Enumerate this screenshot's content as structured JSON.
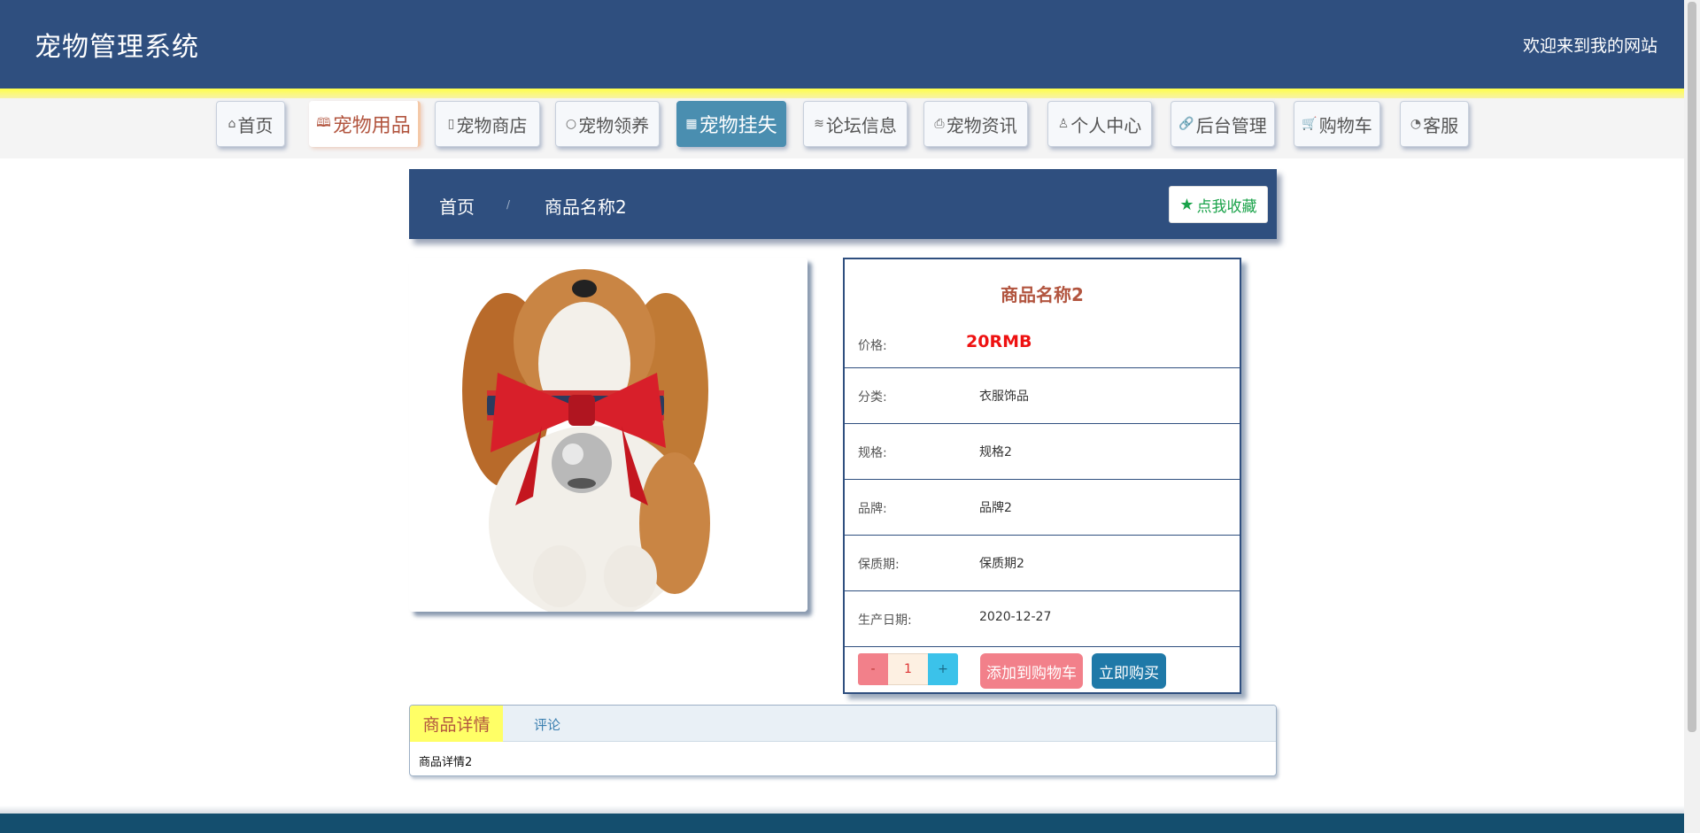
{
  "header": {
    "title": "宠物管理系统",
    "welcome": "欢迎来到我的网站"
  },
  "nav": {
    "items": [
      {
        "label": "首页",
        "icon": "home-icon",
        "glyph": "⌂"
      },
      {
        "label": "宠物用品",
        "icon": "book-icon",
        "glyph": "🕮"
      },
      {
        "label": "宠物商店",
        "icon": "document-icon",
        "glyph": "▯"
      },
      {
        "label": "宠物领养",
        "icon": "circle-icon",
        "glyph": "○"
      },
      {
        "label": "宠物挂失",
        "icon": "grid-icon",
        "glyph": "▦"
      },
      {
        "label": "论坛信息",
        "icon": "layers-icon",
        "glyph": "≋"
      },
      {
        "label": "宠物资讯",
        "icon": "print-icon",
        "glyph": "⎙"
      },
      {
        "label": "个人中心",
        "icon": "user-icon",
        "glyph": "♙"
      },
      {
        "label": "后台管理",
        "icon": "link-icon",
        "glyph": "🔗"
      },
      {
        "label": "购物车",
        "icon": "cart-icon",
        "glyph": "🛒"
      },
      {
        "label": "客服",
        "icon": "support-icon",
        "glyph": "◔"
      }
    ],
    "active_index": 4,
    "accent_index": 1
  },
  "breadcrumb": {
    "home": "首页",
    "separator": "/",
    "current": "商品名称2",
    "favorite_label": "点我收藏",
    "favorite_icon": "star-icon"
  },
  "product": {
    "image_alt": "dog-with-bell-collar",
    "name": "商品名称2",
    "price_label": "价格:",
    "price": "20RMB",
    "fields": [
      {
        "label": "分类:",
        "value": "衣服饰品"
      },
      {
        "label": "规格:",
        "value": "规格2"
      },
      {
        "label": "品牌:",
        "value": "品牌2"
      },
      {
        "label": "保质期:",
        "value": "保质期2"
      },
      {
        "label": "生产日期:",
        "value": "2020-12-27"
      }
    ],
    "quantity": {
      "minus": "-",
      "value": "1",
      "plus": "+"
    },
    "add_to_cart": "添加到购物车",
    "buy_now": "立即购买"
  },
  "tabs": {
    "detail_tab": "商品详情",
    "comment_tab": "评论",
    "detail_text": "商品详情2"
  },
  "colors": {
    "primary": "#2f4f7f",
    "accent_yellow": "#ffff66",
    "price_red": "#ee1111",
    "title_brown": "#b2553f",
    "favorite_green": "#1aa34a"
  }
}
